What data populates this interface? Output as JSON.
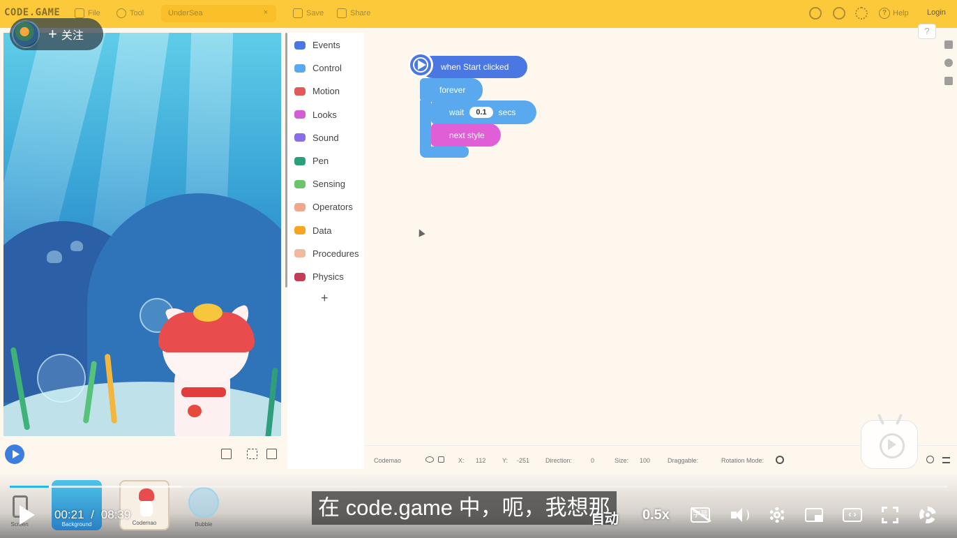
{
  "topbar": {
    "logo": "CODE.GAME",
    "file": "File",
    "tool": "Tool",
    "project_name": "UnderSea",
    "project_close": "×",
    "save": "Save",
    "share": "Share",
    "help": "Help",
    "login": "Login"
  },
  "overlay": {
    "follow_plus": "+",
    "follow_label": "关注"
  },
  "categories": [
    {
      "label": "Events",
      "color": "#4a77e2"
    },
    {
      "label": "Control",
      "color": "#5aa9ef"
    },
    {
      "label": "Motion",
      "color": "#e05a5a"
    },
    {
      "label": "Looks",
      "color": "#d45cd4"
    },
    {
      "label": "Sound",
      "color": "#8a6ee6"
    },
    {
      "label": "Pen",
      "color": "#2a9f7a"
    },
    {
      "label": "Sensing",
      "color": "#6cc36c"
    },
    {
      "label": "Operators",
      "color": "#f0a88a"
    },
    {
      "label": "Data",
      "color": "#f5a623"
    },
    {
      "label": "Procedures",
      "color": "#f2b8a0"
    },
    {
      "label": "Physics",
      "color": "#c43c56"
    }
  ],
  "palette_add": "+",
  "blocks": {
    "hat": "when Start clicked",
    "forever": "forever",
    "wait": "wait",
    "wait_value": "0.1",
    "secs": "secs",
    "next_style": "next style"
  },
  "help_q": "?",
  "sprite_info": {
    "name": "Codemao",
    "x_label": "X:",
    "x_value": "112",
    "y_label": "Y:",
    "y_value": "-251",
    "direction_label": "Direction:",
    "direction_value": "0",
    "size_label": "Size:",
    "size_value": "100",
    "draggable_label": "Draggable:",
    "rotation_label": "Rotation Mode:"
  },
  "sprites": {
    "screen": "Screen",
    "background": "Background",
    "codemao": "Codemao",
    "bubble": "Bubble"
  },
  "video": {
    "current_time": "00:21",
    "separator": "/",
    "duration": "08:39",
    "progress": 0.042,
    "subtitle": "在 code.game 中，呃，我想那",
    "auto": "自动",
    "speed": "0.5x",
    "cc": "字幕"
  },
  "colors": {
    "topbar": "#fcc93a",
    "events_block": "#4a77e2",
    "control_block": "#5aa9ef",
    "looks_block": "#e05fd6",
    "progress": "#2bb6ea"
  }
}
